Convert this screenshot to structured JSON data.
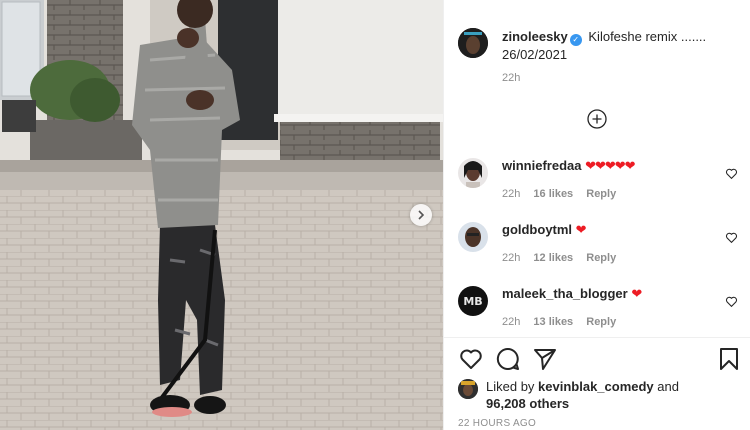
{
  "post": {
    "author": "zinoleesky",
    "caption": "Kilofeshe remix ....... 26/02/2021",
    "caption_time": "22h"
  },
  "comments": [
    {
      "username": "winniefredaa",
      "text": "❤❤❤❤❤",
      "time": "22h",
      "likes": "16 likes",
      "reply": "Reply"
    },
    {
      "username": "goldboytml",
      "text": "❤",
      "time": "22h",
      "likes": "12 likes",
      "reply": "Reply"
    },
    {
      "username": "maleek_tha_blogger",
      "text": "❤",
      "time": "22h",
      "likes": "13 likes",
      "reply": "Reply"
    }
  ],
  "likes": {
    "prefix": "Liked by",
    "user": "kevinblak_comedy",
    "and": "and",
    "others": "96,208 others"
  },
  "posted_ago": "22 HOURS AGO",
  "icons": {
    "verified": "verified-badge-icon",
    "load_more": "plus-circle-icon",
    "like": "heart-icon",
    "comment": "comment-bubble-icon",
    "share": "paper-plane-icon",
    "save": "bookmark-icon",
    "next": "chevron-right-icon"
  },
  "colors": {
    "verified_blue": "#3897f0",
    "heart_red": "#ed1c24",
    "muted_text": "#8e8e8e"
  }
}
